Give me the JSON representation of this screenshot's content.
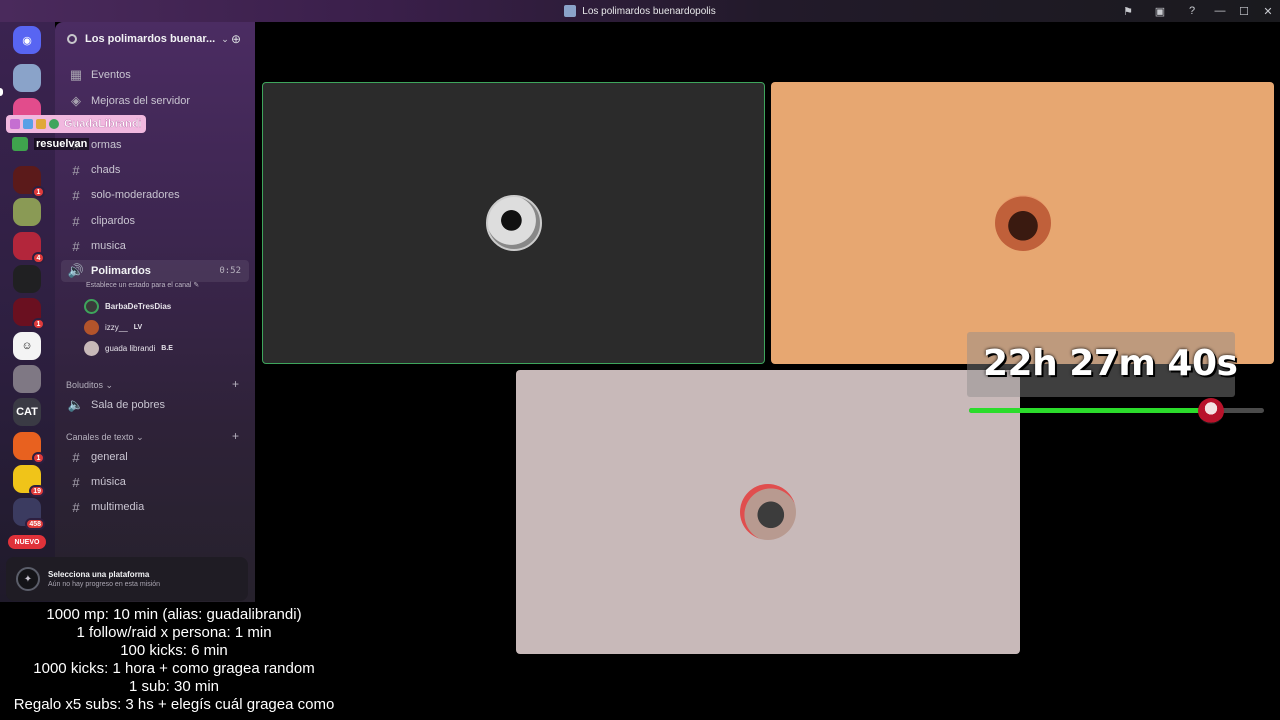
{
  "window": {
    "title": "Los polimardos buenardopolis"
  },
  "titlebar_icons": [
    "flag-icon",
    "inbox-icon",
    "help-icon"
  ],
  "server": {
    "name": "Los polimardos buenar...",
    "items": [
      {
        "label": "Eventos",
        "icon": "calendar-icon"
      },
      {
        "label": "Mejoras del servidor",
        "icon": "boost-icon"
      }
    ],
    "channels": [
      {
        "label": "ormas"
      },
      {
        "label": "chads"
      },
      {
        "label": "solo-moderadores"
      },
      {
        "label": "clipardos"
      },
      {
        "label": "musica"
      }
    ],
    "voice_channel": {
      "label": "Polimardos",
      "time": "0:52",
      "status": "Establece un estado para el canal",
      "users": [
        {
          "name": "BarbaDeTresDias",
          "tag": ""
        },
        {
          "name": "izzy__",
          "tag": "LV"
        },
        {
          "name": "guada librandi",
          "tag": "B.E"
        }
      ]
    },
    "categories": [
      {
        "label": "Boluditos",
        "channels": [
          {
            "label": "Sala de pobres",
            "type": "voice"
          }
        ]
      },
      {
        "label": "Canales de texto",
        "channels": [
          {
            "label": "general"
          },
          {
            "label": "música"
          },
          {
            "label": "multimedia"
          }
        ]
      }
    ]
  },
  "rail": {
    "badges": [
      "1",
      "4",
      "1",
      "1",
      "19",
      "458"
    ],
    "cat_label": "CAT",
    "nuevo": "NUEVO"
  },
  "quest": {
    "title": "Selecciona una plataforma",
    "subtitle": "Aún no hay progreso en esta misión"
  },
  "overlay": {
    "user1": "GuadaLibrandi",
    "user2": "resuelvan"
  },
  "timer": {
    "text": "22h 27m 40s",
    "progress": 0.79
  },
  "rules": [
    "1000 mp: 10 min (alias: guadalibrandi)",
    "1 follow/raid x persona: 1 min",
    "100 kicks: 6 min",
    "1000 kicks: 1 hora + como gragea random",
    "1 sub: 30 min",
    "Regalo x5 subs: 3 hs + elegís cuál gragea como"
  ],
  "colors": {
    "speaking_border": "#3ea55c",
    "tile2_bg": "#e7a771",
    "tile3_bg": "#c8b9b9",
    "progress_fill": "#2bdc2b"
  }
}
